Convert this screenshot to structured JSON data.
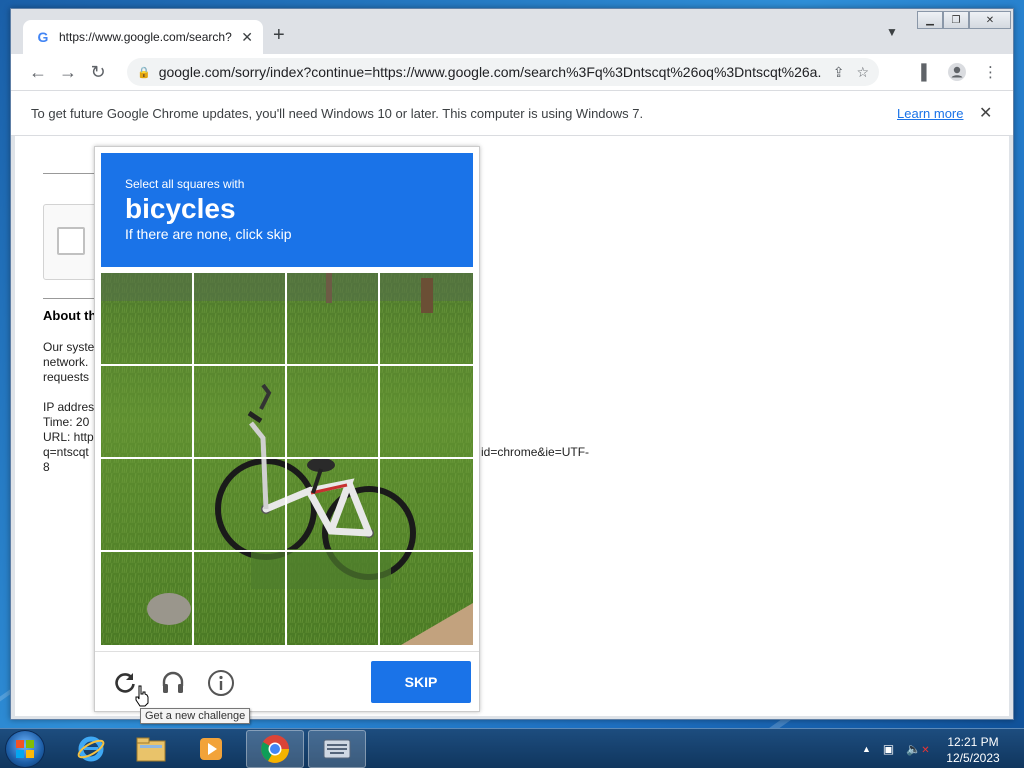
{
  "browser": {
    "tab_title": "https://www.google.com/search?",
    "url": "google.com/sorry/index?continue=https://www.google.com/search%3Fq%3Dntscqt%26oq%3Dntscqt%26a...",
    "infobar_text": "To get future Google Chrome updates, you'll need Windows 10 or later. This computer is using Windows 7.",
    "infobar_link": "Learn more"
  },
  "page": {
    "about_heading": "About th",
    "para1": [
      "Our syste",
      "network.",
      "requests"
    ],
    "details": [
      "IP addres",
      "Time: 20",
      "URL: http",
      "q=ntscqt",
      "8"
    ],
    "url_tail": "id=chrome&ie=UTF-"
  },
  "captcha": {
    "instruction_small": "Select all squares with",
    "target": "bicycles",
    "instruction_sub": "If there are none, click skip",
    "skip_label": "SKIP",
    "tooltip": "Get a new challenge",
    "header_color": "#1a73e8"
  },
  "taskbar": {
    "time": "12:21 PM",
    "date": "12/5/2023"
  }
}
